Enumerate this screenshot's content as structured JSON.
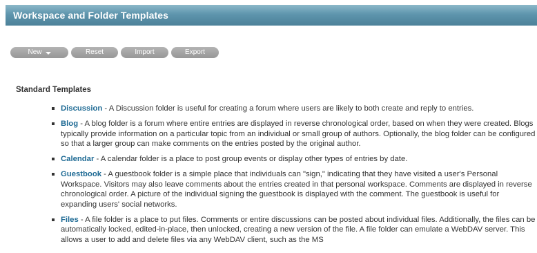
{
  "header": {
    "title": "Workspace and Folder Templates"
  },
  "toolbar": {
    "new_label": "New",
    "reset_label": "Reset",
    "import_label": "Import",
    "export_label": "Export"
  },
  "section": {
    "heading": "Standard Templates"
  },
  "templates": [
    {
      "term": "Discussion",
      "description": " - A Discussion folder is useful for creating a forum where users are likely to both create and reply to entries."
    },
    {
      "term": "Blog",
      "description": " - A blog folder is a forum where entire entries are displayed in reverse chronological order, based on when they were created. Blogs typically provide information on a particular topic from an individual or small group of authors. Optionally, the blog folder can be configured so that a larger group can make comments on the entries posted by the original author."
    },
    {
      "term": "Calendar",
      "description": " - A calendar folder is a place to post group events or display other types of entries by date."
    },
    {
      "term": "Guestbook",
      "description": " - A guestbook folder is a simple place that individuals can \"sign,\" indicating that they have visited a user's Personal Workspace. Visitors may also leave comments about the entries created in that personal workspace. Comments are displayed in reverse chronological order. A picture of the individual signing the guestbook is displayed with the comment. The guestbook is useful for expanding users' social networks."
    },
    {
      "term": "Files",
      "description": " - A file folder is a place to put files. Comments or entire discussions can be posted about individual files. Additionally, the files can be automatically locked, edited-in-place, then unlocked, creating a new version of the file. A file folder can emulate a WebDAV server. This allows a user to add and delete files via any WebDAV client, such as the MS"
    }
  ]
}
